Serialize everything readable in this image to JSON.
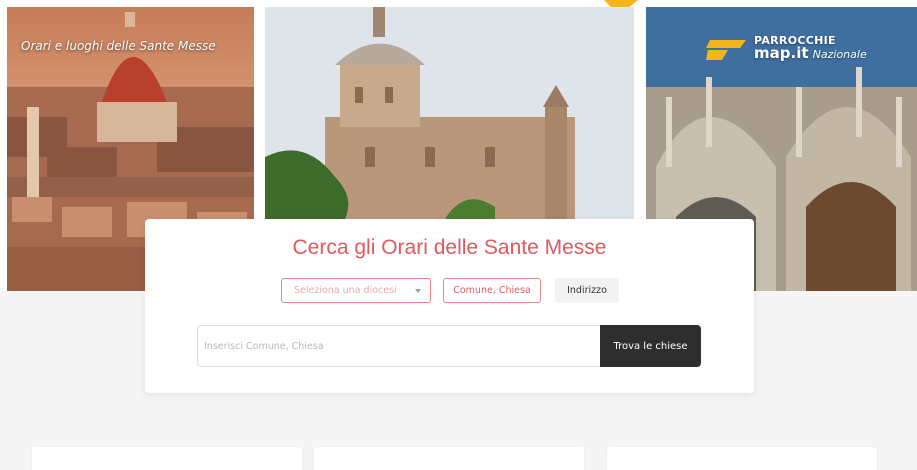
{
  "hero": {
    "left_caption": "Orari e luoghi delle Sante Messe",
    "logo": {
      "line1": "PARROCCHIE",
      "brand": "map",
      "tld": ".it",
      "suffix": "Nazionale"
    }
  },
  "search": {
    "title": "Cerca gli Orari delle Sante Messe",
    "diocese_select_placeholder": "Seleziona una diocesi",
    "mode_comune_label": "Comune, Chiesa",
    "mode_indirizzo_label": "Indirizzo",
    "input_placeholder": "Inserisci Comune, Chiesa",
    "input_value": "",
    "submit_label": "Trova le chiese"
  },
  "colors": {
    "accent": "#e05a60",
    "button_dark": "#2e2e2e",
    "logo_yellow": "#f2b51a"
  }
}
